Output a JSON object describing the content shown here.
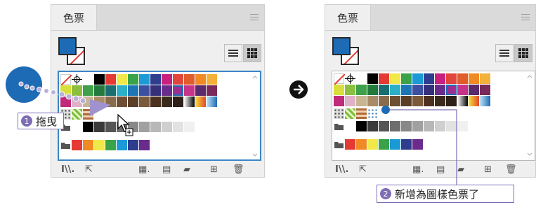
{
  "left_panel": {
    "tab_label": "色票",
    "panel_menu_icon": "hamburger-menu-icon",
    "list_view_icon": "list-view-icon",
    "grid_view_icon": "grid-view-icon",
    "footer_icons": [
      "swatch-library-icon",
      "place-swatch-icon",
      "show-swatch-kinds-icon",
      "swatch-options-icon",
      "new-color-group-icon",
      "new-swatch-icon",
      "delete-swatch-icon"
    ]
  },
  "right_panel": {
    "tab_label": "色票",
    "panel_menu_icon": "hamburger-menu-icon",
    "list_view_icon": "list-view-icon",
    "grid_view_icon": "grid-view-icon",
    "footer_icons": [
      "swatch-library-icon",
      "place-swatch-icon",
      "show-swatch-kinds-icon",
      "swatch-options-icon",
      "new-color-group-icon",
      "new-swatch-icon",
      "delete-swatch-icon"
    ]
  },
  "callouts": {
    "drag": {
      "number": "1",
      "text": "拖曳"
    },
    "added": {
      "number": "2",
      "text": "新增為圖樣色票了"
    }
  },
  "arrow_icon": "right-arrow-circle-icon",
  "colors": {
    "accent": "#7e6db5",
    "selection_blue": "#3a86c8",
    "dragged_object": "#1e6bb5",
    "panel_bg": "#efefef"
  },
  "swatches": {
    "row1": [
      "none",
      "registration",
      "#ffffff",
      "#000000",
      "#e53a33",
      "#f1e84a",
      "#3aa34a",
      "#1c9ad6",
      "#2f3d8f",
      "#c8207f",
      "#e0463b",
      "#e05d2b",
      "#f08a24",
      "#f3b13a"
    ],
    "row2": [
      "#d8df3a",
      "#8dbf3f",
      "#3ea04a",
      "#247a3d",
      "#1a6e70",
      "#2bb0c8",
      "#1e75b5",
      "#3d4fa0",
      "#35307a",
      "#6a2c8c",
      "#9b2f8f",
      "#c63489",
      "#5a2a6a",
      "#7a2a5a"
    ],
    "row3": [
      "#c02a7a",
      "#e0b0c8",
      "#c7b593",
      "#a98c67",
      "#8a6c4c",
      "#6e4f34",
      "#5b3e26",
      "#7a5a3a",
      "#4c3020",
      "#3a2a1c",
      "#2e2018",
      "gradient-bw",
      "gradient-orange",
      "gradient-blue"
    ],
    "row4_patterns_left": [
      "pattern-dots",
      "pattern-leaf",
      "pattern-tile"
    ],
    "row4_patterns_right": [
      "pattern-dots",
      "pattern-leaf",
      "pattern-tile",
      "pattern-new"
    ],
    "row5": [
      "folder",
      "#ffffff",
      "#000000",
      "#3a3a3a",
      "#555555",
      "#6e6e6e",
      "#888888",
      "#a0a0a0",
      "#b8b8b8",
      "#cfcfcf",
      "#e2e2e2",
      "#f0f0f0"
    ],
    "row6": [
      "folder",
      "#e53a33",
      "#f08a24",
      "#f1e84a",
      "#3aa34a",
      "#1c9ad6",
      "#2f3d8f",
      "#6a2c8c"
    ]
  }
}
